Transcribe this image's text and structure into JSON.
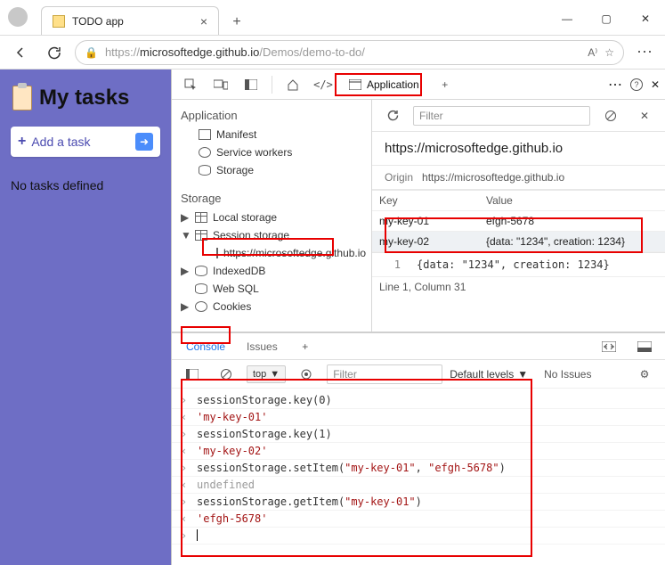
{
  "browser": {
    "tab_title": "TODO app",
    "url_dim_prefix": "https://",
    "url_host": "microsoftedge.github.io",
    "url_path": "/Demos/demo-to-do/"
  },
  "page": {
    "title": "My tasks",
    "add_task": "Add a task",
    "no_tasks": "No tasks defined"
  },
  "devtools": {
    "active_tab": "Application",
    "more": "⋯",
    "help": "?"
  },
  "app_sidebar": {
    "section_app": "Application",
    "manifest": "Manifest",
    "service_workers": "Service workers",
    "storage": "Storage",
    "section_storage": "Storage",
    "local_storage": "Local storage",
    "session_storage": "Session storage",
    "session_origin": "https://microsoftedge.github.io",
    "indexeddb": "IndexedDB",
    "websql": "Web SQL",
    "cookies": "Cookies"
  },
  "app_right": {
    "filter_placeholder": "Filter",
    "origin_title": "https://microsoftedge.github.io",
    "origin_label": "Origin",
    "origin_value": "https://microsoftedge.github.io",
    "col_key": "Key",
    "col_value": "Value",
    "rows": [
      {
        "key": "my-key-01",
        "value": "efgh-5678"
      },
      {
        "key": "my-key-02",
        "value": "{data: \"1234\", creation: 1234}"
      }
    ],
    "detail_line_num": "1",
    "detail_value": "{data: \"1234\", creation: 1234}",
    "status": "Line 1, Column 31"
  },
  "drawer": {
    "tab_console": "Console",
    "tab_issues": "Issues",
    "ctx": "top",
    "filter_placeholder": "Filter",
    "levels": "Default levels",
    "no_issues": "No Issues"
  },
  "console": [
    {
      "t": "in",
      "text": "sessionStorage.key(0)"
    },
    {
      "t": "out",
      "text": "'my-key-01'"
    },
    {
      "t": "in",
      "text": "sessionStorage.key(1)"
    },
    {
      "t": "out",
      "text": "'my-key-02'"
    },
    {
      "t": "in",
      "text": "sessionStorage.setItem(\"my-key-01\", \"efgh-5678\")"
    },
    {
      "t": "und",
      "text": "undefined"
    },
    {
      "t": "in",
      "text": "sessionStorage.getItem(\"my-key-01\")"
    },
    {
      "t": "out",
      "text": "'efgh-5678'"
    }
  ]
}
